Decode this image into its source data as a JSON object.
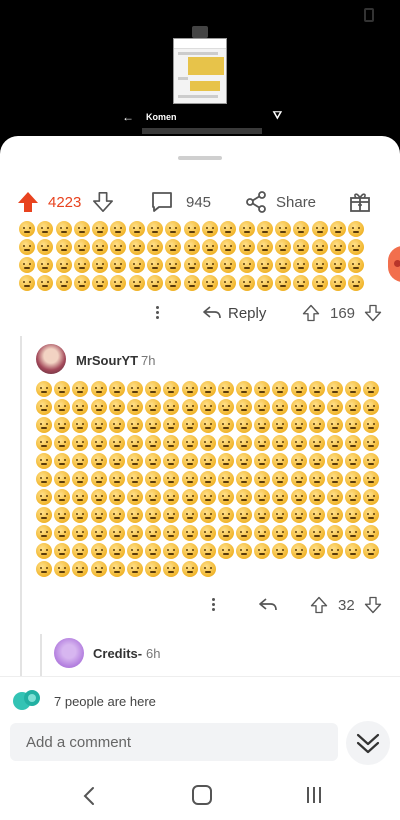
{
  "preview": {
    "title": "Komen"
  },
  "action_bar": {
    "upvote_count": "4223",
    "comment_count": "945",
    "share_label": "Share"
  },
  "top_comment": {
    "reply_label": "Reply",
    "vote_count": "169",
    "emoji_rows_visible": 4,
    "emoji_per_row": 19
  },
  "reply_comment": {
    "username": "MrSourYT",
    "time": "7h",
    "vote_count": "32",
    "emoji_full_rows": 10,
    "emoji_last_row": 10,
    "emoji_per_row": 19
  },
  "nested_comment": {
    "username": "Credits-",
    "time": "6h"
  },
  "presence": {
    "text": "7 people are here"
  },
  "composer": {
    "placeholder": "Add a comment"
  },
  "colors": {
    "accent": "#e8431f",
    "muted": "#555555"
  }
}
